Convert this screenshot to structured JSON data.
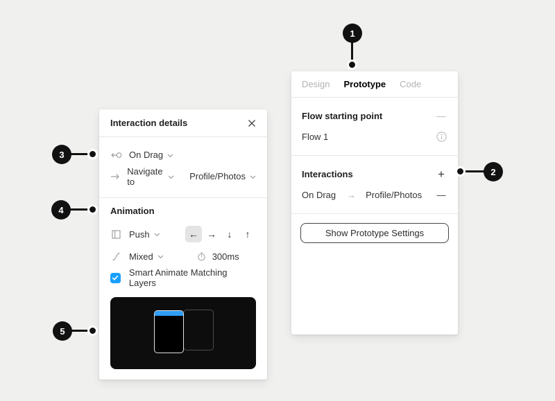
{
  "colors": {
    "background": "#f0f0ef",
    "panel_bg": "#ffffff",
    "divider": "#e6e6e6",
    "text_primary": "#1e1e1e",
    "text_inactive": "#b3b3b3",
    "icon_gray": "#a0a0a0",
    "accent_blue": "#18a0fb",
    "preview_bar_blue": "#2e9df5",
    "callout_black": "#111111",
    "selected_control_bg": "#e4e4e4"
  },
  "callouts": [
    {
      "number": "1"
    },
    {
      "number": "2"
    },
    {
      "number": "3"
    },
    {
      "number": "4"
    },
    {
      "number": "5"
    }
  ],
  "interaction_details": {
    "title": "Interaction details",
    "trigger_label": "On Drag",
    "action_label": "Navigate to",
    "action_target": "Profile/Photos",
    "animation": {
      "heading": "Animation",
      "type_label": "Push",
      "directions": [
        "←",
        "→",
        "↓",
        "↑"
      ],
      "selected_direction": "←",
      "easing_label": "Mixed",
      "duration": "300ms",
      "checkbox_label": "Smart Animate Matching Layers",
      "checkbox_checked": true
    }
  },
  "prototype_panel": {
    "tabs": [
      {
        "label": "Design"
      },
      {
        "label": "Prototype"
      },
      {
        "label": "Code"
      }
    ],
    "active_tab": "Prototype",
    "flow_heading": "Flow starting point",
    "flow_name": "Flow 1",
    "interactions_heading": "Interactions",
    "interaction_row": {
      "trigger": "On Drag",
      "arrow": "→",
      "target": "Profile/Photos"
    },
    "settings_button_label": "Show Prototype Settings"
  },
  "glyphs": {
    "plus": "+",
    "minus": "—"
  }
}
